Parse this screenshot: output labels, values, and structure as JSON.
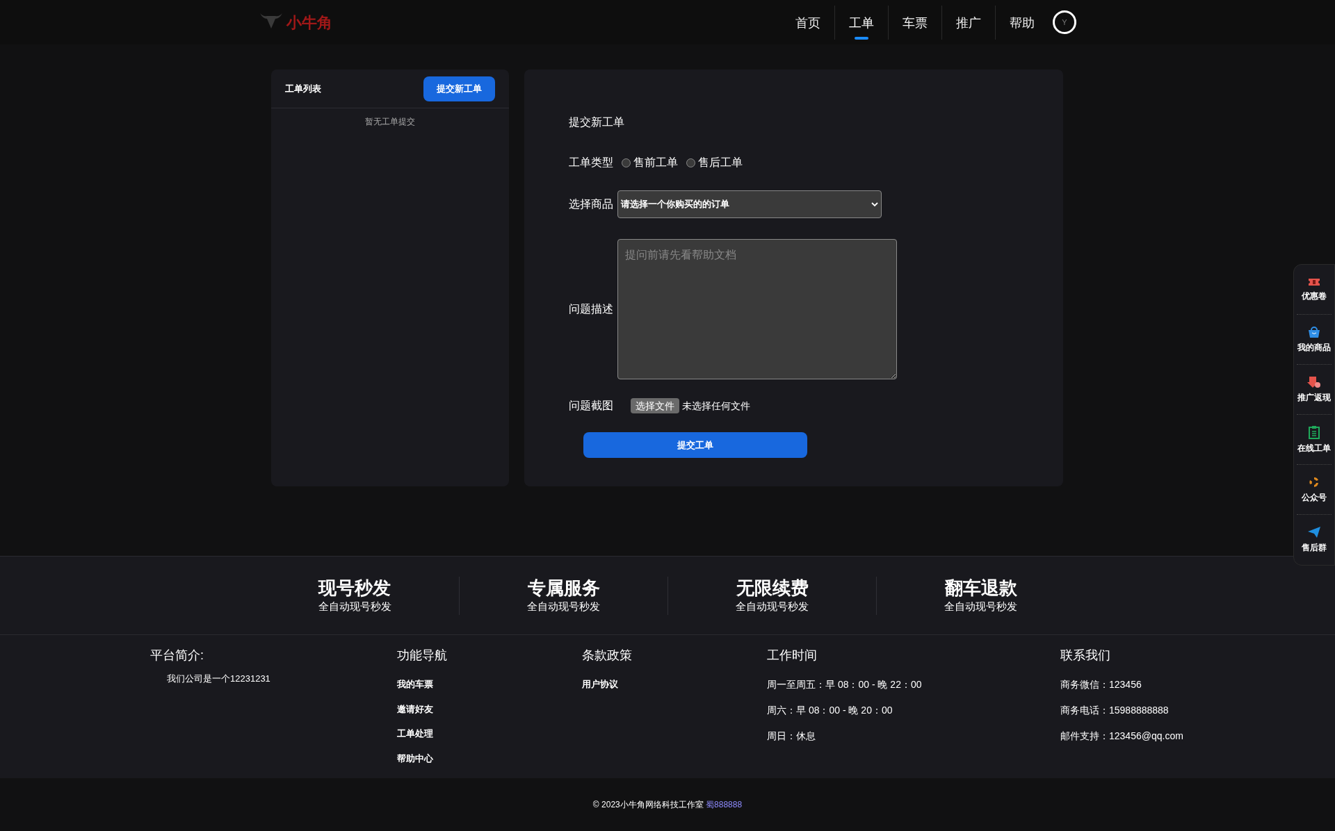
{
  "header": {
    "logo_text": "小牛角",
    "nav": [
      {
        "label": "首页",
        "selected": false
      },
      {
        "label": "工单",
        "selected": true
      },
      {
        "label": "车票",
        "selected": false
      },
      {
        "label": "推广",
        "selected": false
      },
      {
        "label": "帮助",
        "selected": false
      }
    ],
    "avatar_letter": "Y"
  },
  "ticket_list": {
    "title": "工单列表",
    "new_button": "提交新工单",
    "empty_text": "暂无工单提交"
  },
  "form": {
    "title": "提交新工单",
    "type_label": "工单类型",
    "types": [
      {
        "label": "售前工单",
        "selected": false
      },
      {
        "label": "售后工单",
        "selected": false
      }
    ],
    "product_label": "选择商品",
    "product_value": "请选择一个你购买的的订单",
    "description_label": "问题描述",
    "description_placeholder": "提问前请先看帮助文档",
    "screenshot_label": "问题截图",
    "file_button": "选择文件",
    "file_status": "未选择任何文件",
    "submit": "提交工单"
  },
  "side_menu": [
    {
      "kind": "coupon",
      "label": "优惠卷"
    },
    {
      "kind": "bag",
      "label": "我的商品"
    },
    {
      "kind": "cashback",
      "label": "推广返现"
    },
    {
      "kind": "clipboard",
      "label": "在线工单"
    },
    {
      "kind": "swirl",
      "label": "公众号"
    },
    {
      "kind": "plane",
      "label": "售后群"
    }
  ],
  "features": [
    {
      "title": "现号秒发",
      "subtitle": "全自动现号秒发"
    },
    {
      "title": "专属服务",
      "subtitle": "全自动现号秒发"
    },
    {
      "title": "无限续费",
      "subtitle": "全自动现号秒发"
    },
    {
      "title": "翻车退款",
      "subtitle": "全自动现号秒发"
    }
  ],
  "footer": {
    "about_title": "平台简介:",
    "about_text": "我们公司是一个12231231",
    "nav_title": "功能导航",
    "nav_links": [
      "我的车票",
      "邀请好友",
      "工单处理",
      "帮助中心"
    ],
    "policy_title": "条款政策",
    "policy_links": [
      "用户协议"
    ],
    "hours_title": "工作时间",
    "hours": [
      "周一至周五：早 08：00 - 晚 22：00",
      "周六：早 08：00 - 晚 20：00",
      "周日：休息"
    ],
    "contact_title": "联系我们",
    "contacts": [
      "商务微信：123456",
      "商务电话：15988888888",
      "邮件支持：123456@qq.com"
    ]
  },
  "copyright": {
    "text": "© 2023小牛角网络科技工作室",
    "link": "蜀888888"
  }
}
